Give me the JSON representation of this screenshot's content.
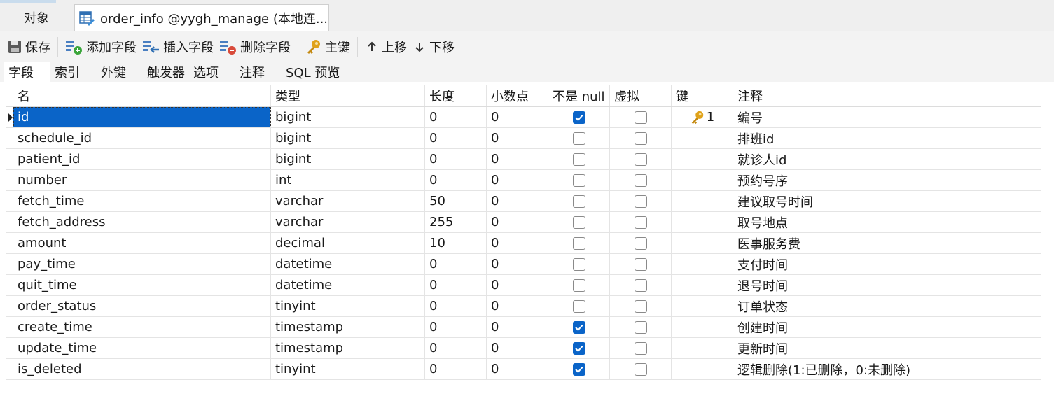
{
  "window": {
    "objects_tab": "对象",
    "active_tab": "order_info @yygh_manage (本地连..."
  },
  "toolbar": {
    "save": "保存",
    "add_field": "添加字段",
    "insert_field": "插入字段",
    "delete_field": "删除字段",
    "primary_key": "主键",
    "move_up": "上移",
    "move_down": "下移"
  },
  "subtabs": [
    "字段",
    "索引",
    "外键",
    "触发器",
    "选项",
    "注释",
    "SQL 预览"
  ],
  "columns": [
    "名",
    "类型",
    "长度",
    "小数点",
    "不是 null",
    "虚拟",
    "键",
    "注释"
  ],
  "rows": [
    {
      "name": "id",
      "type": "bigint",
      "length": "0",
      "decimals": "0",
      "not_null": true,
      "virtual": false,
      "key": "1",
      "comment": "编号"
    },
    {
      "name": "schedule_id",
      "type": "bigint",
      "length": "0",
      "decimals": "0",
      "not_null": false,
      "virtual": false,
      "key": "",
      "comment": "排班id"
    },
    {
      "name": "patient_id",
      "type": "bigint",
      "length": "0",
      "decimals": "0",
      "not_null": false,
      "virtual": false,
      "key": "",
      "comment": "就诊人id"
    },
    {
      "name": "number",
      "type": "int",
      "length": "0",
      "decimals": "0",
      "not_null": false,
      "virtual": false,
      "key": "",
      "comment": "预约号序"
    },
    {
      "name": "fetch_time",
      "type": "varchar",
      "length": "50",
      "decimals": "0",
      "not_null": false,
      "virtual": false,
      "key": "",
      "comment": "建议取号时间"
    },
    {
      "name": "fetch_address",
      "type": "varchar",
      "length": "255",
      "decimals": "0",
      "not_null": false,
      "virtual": false,
      "key": "",
      "comment": "取号地点"
    },
    {
      "name": "amount",
      "type": "decimal",
      "length": "10",
      "decimals": "0",
      "not_null": false,
      "virtual": false,
      "key": "",
      "comment": "医事服务费"
    },
    {
      "name": "pay_time",
      "type": "datetime",
      "length": "0",
      "decimals": "0",
      "not_null": false,
      "virtual": false,
      "key": "",
      "comment": "支付时间"
    },
    {
      "name": "quit_time",
      "type": "datetime",
      "length": "0",
      "decimals": "0",
      "not_null": false,
      "virtual": false,
      "key": "",
      "comment": "退号时间"
    },
    {
      "name": "order_status",
      "type": "tinyint",
      "length": "0",
      "decimals": "0",
      "not_null": false,
      "virtual": false,
      "key": "",
      "comment": "订单状态"
    },
    {
      "name": "create_time",
      "type": "timestamp",
      "length": "0",
      "decimals": "0",
      "not_null": true,
      "virtual": false,
      "key": "",
      "comment": "创建时间"
    },
    {
      "name": "update_time",
      "type": "timestamp",
      "length": "0",
      "decimals": "0",
      "not_null": true,
      "virtual": false,
      "key": "",
      "comment": "更新时间"
    },
    {
      "name": "is_deleted",
      "type": "tinyint",
      "length": "0",
      "decimals": "0",
      "not_null": true,
      "virtual": false,
      "key": "",
      "comment": "逻辑删除(1:已删除，0:未删除)"
    }
  ],
  "colors": {
    "accent": "#0a64c8",
    "key_gold": "#e0a21a"
  }
}
